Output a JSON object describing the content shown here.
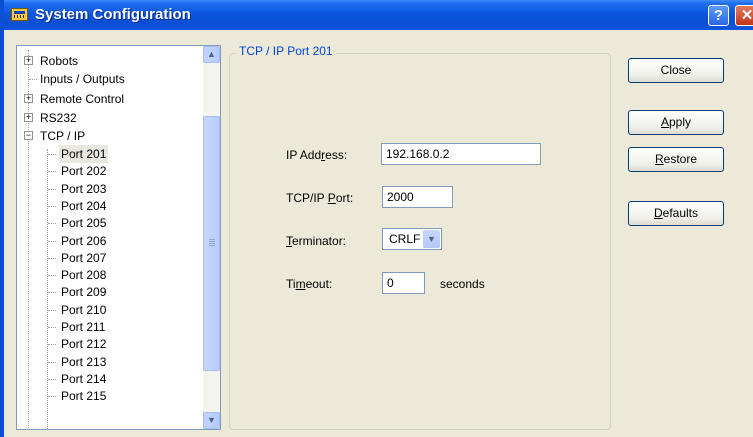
{
  "window": {
    "title": "System Configuration",
    "help_glyph": "?",
    "close_glyph": "✕"
  },
  "tree": {
    "items": [
      {
        "label": "Robots",
        "expander": "+"
      },
      {
        "label": "Inputs / Outputs",
        "expander": ""
      },
      {
        "label": "Remote Control",
        "expander": "+"
      },
      {
        "label": "RS232",
        "expander": "+"
      },
      {
        "label": "TCP / IP",
        "expander": "−"
      }
    ],
    "ports": [
      "Port 201",
      "Port 202",
      "Port 203",
      "Port 204",
      "Port 205",
      "Port 206",
      "Port 207",
      "Port 208",
      "Port 209",
      "Port 210",
      "Port 211",
      "Port 212",
      "Port 213",
      "Port 214",
      "Port 215"
    ],
    "selected": "Port 201",
    "scroll_up_glyph": "▲",
    "scroll_down_glyph": "▼"
  },
  "panel": {
    "group_title": "TCP / IP Port 201",
    "ip_label_pre": "IP Add",
    "ip_label_key": "r",
    "ip_label_post": "ess:",
    "ip_value": "192.168.0.2",
    "port_label_pre": "TCP/IP ",
    "port_label_key": "P",
    "port_label_post": "ort:",
    "port_value": "2000",
    "terminator_label_key": "T",
    "terminator_label_post": "erminator:",
    "terminator_value": "CRLF",
    "dropdown_glyph": "▼",
    "timeout_label_pre": "Ti",
    "timeout_label_key": "m",
    "timeout_label_post": "eout:",
    "timeout_value": "0",
    "timeout_unit": "seconds"
  },
  "buttons": {
    "close": "Close",
    "apply_key": "A",
    "apply_rest": "pply",
    "restore_key": "R",
    "restore_rest": "estore",
    "defaults_key": "D",
    "defaults_rest": "efaults"
  }
}
